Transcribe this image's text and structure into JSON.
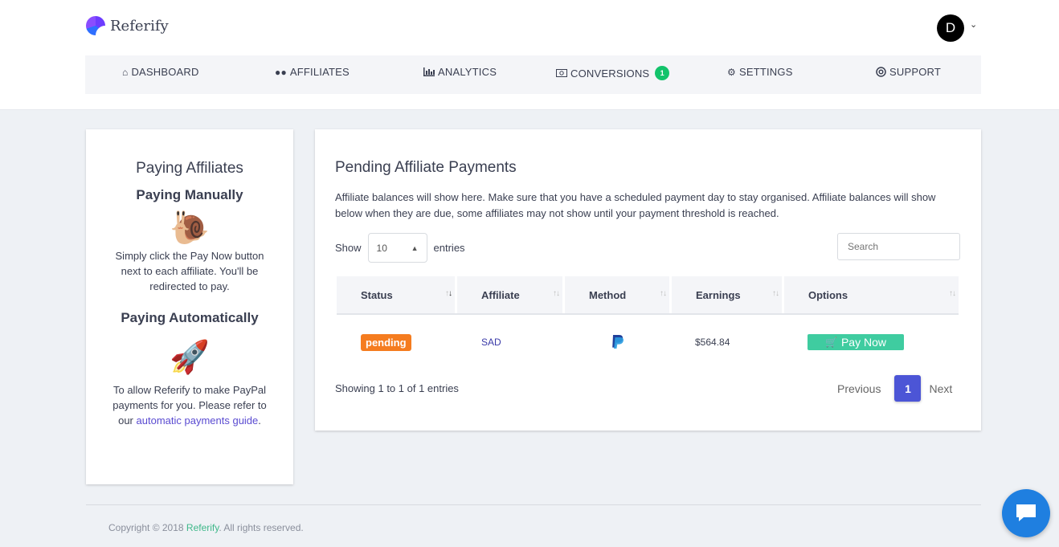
{
  "app": {
    "name": "Referify"
  },
  "user": {
    "initial": "D"
  },
  "nav": {
    "dashboard": "DASHBOARD",
    "affiliates": "AFFILIATES",
    "analytics": "ANALYTICS",
    "conversions": "CONVERSIONS",
    "conversions_count": "1",
    "settings": "SETTINGS",
    "support": "SUPPORT"
  },
  "sidebar": {
    "title": "Paying Affiliates",
    "manual_heading": "Paying Manually",
    "manual_text": "Simply click the Pay Now button next to each affiliate. You'll be redirected to pay.",
    "auto_heading": "Paying Automatically",
    "auto_text": "To allow Referify to make PayPal payments for you. Please refer to our",
    "auto_link": "automatic payments guide",
    "auto_end": "."
  },
  "main": {
    "title": "Pending Affiliate Payments",
    "description": "Affiliate balances will show here. Make sure that you have a scheduled payment day to stay organised. Affiliate balances will show below when they are due, some affiliates may not show until your payment threshold is reached.",
    "show_label": "Show",
    "entries_value": "10",
    "entries_label": "entries",
    "search_placeholder": "Search",
    "columns": [
      "Status",
      "Affiliate",
      "Method",
      "Earnings",
      "Options"
    ],
    "rows": [
      {
        "status": "pending",
        "affiliate": "SAD",
        "method": "paypal-icon",
        "earnings": "$564.84",
        "action": "Pay Now"
      }
    ],
    "showing": "Showing 1 to 1 of 1 entries",
    "pager": {
      "previous": "Previous",
      "current": "1",
      "next": "Next"
    }
  },
  "footer": {
    "prefix": "Copyright © 2018",
    "brand": "Referify",
    "suffix": ". All rights reserved."
  },
  "colors": {
    "accent": "#4c55d6",
    "pending": "#f57c1f",
    "pay_button": "#3fcca0",
    "badge": "#12c36b",
    "chat": "#1f7fe0"
  }
}
